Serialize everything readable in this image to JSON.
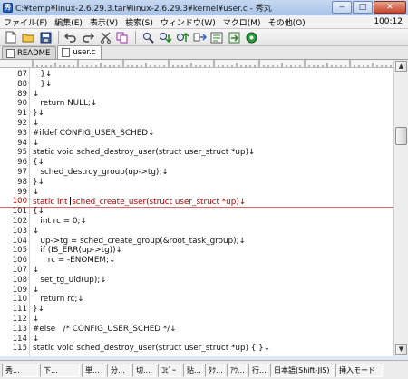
{
  "window": {
    "title": "C:¥temp¥linux-2.6.29.3.tar¥linux-2.6.29.3¥kernel¥user.c - 秀丸",
    "minimize": "‒",
    "maximize": "□",
    "close": "✕"
  },
  "menu": {
    "items": [
      "ファイル(F)",
      "編集(E)",
      "表示(V)",
      "検索(S)",
      "ウィンドウ(W)",
      "マクロ(M)",
      "その他(O)"
    ],
    "clock": "100:12"
  },
  "toolbar": {
    "buttons": [
      "new-file",
      "open-folder",
      "save",
      "undo",
      "redo",
      "cut",
      "copy",
      "search",
      "search-down",
      "search-up",
      "replace",
      "grep",
      "jump",
      "help"
    ]
  },
  "tabs": [
    {
      "label": "README",
      "active": false
    },
    {
      "label": "user.c",
      "active": true
    }
  ],
  "editor": {
    "lines": [
      {
        "n": "87",
        "text": "   }↓"
      },
      {
        "n": "88",
        "text": "   }↓"
      },
      {
        "n": "89",
        "text": "↓"
      },
      {
        "n": "90",
        "text": "   return NULL;↓"
      },
      {
        "n": "91",
        "text": "}↓"
      },
      {
        "n": "92",
        "text": "↓"
      },
      {
        "n": "93",
        "text": "#ifdef CONFIG_USER_SCHED↓"
      },
      {
        "n": "94",
        "text": "↓"
      },
      {
        "n": "95",
        "text": "static void sched_destroy_user(struct user_struct *up)↓"
      },
      {
        "n": "96",
        "text": "{↓"
      },
      {
        "n": "97",
        "text": "   sched_destroy_group(up->tg);↓"
      },
      {
        "n": "98",
        "text": "}↓"
      },
      {
        "n": "99",
        "text": "↓"
      },
      {
        "n": "100",
        "text": "static int sched_create_user(struct user_struct *up)↓",
        "current": true
      },
      {
        "n": "101",
        "text": "{↓"
      },
      {
        "n": "102",
        "text": "   int rc = 0;↓"
      },
      {
        "n": "103",
        "text": "↓"
      },
      {
        "n": "104",
        "text": "   up->tg = sched_create_group(&root_task_group);↓"
      },
      {
        "n": "105",
        "text": "   if (IS_ERR(up->tg))↓"
      },
      {
        "n": "106",
        "text": "      rc = -ENOMEM;↓"
      },
      {
        "n": "107",
        "text": "↓"
      },
      {
        "n": "108",
        "text": "   set_tg_uid(up);↓"
      },
      {
        "n": "109",
        "text": "↓"
      },
      {
        "n": "110",
        "text": "   return rc;↓"
      },
      {
        "n": "111",
        "text": "}↓"
      },
      {
        "n": "112",
        "text": "↓"
      },
      {
        "n": "113",
        "text": "#else   /* CONFIG_USER_SCHED */↓"
      },
      {
        "n": "114",
        "text": "↓"
      },
      {
        "n": "115",
        "text": "static void sched_destroy_user(struct user_struct *up) { }↓"
      }
    ]
  },
  "status": {
    "cells": [
      "秀...",
      "下...",
      "単...",
      "分...",
      "切...",
      "ｺﾋﾟｰ",
      "貼...",
      "ﾀｸ...",
      "ｱｳ...",
      "行...",
      "日本語(Shift-JIS)",
      "挿入モード"
    ]
  },
  "colors": {
    "current_line": "#b00000",
    "window_frame": "#aac4e8"
  }
}
